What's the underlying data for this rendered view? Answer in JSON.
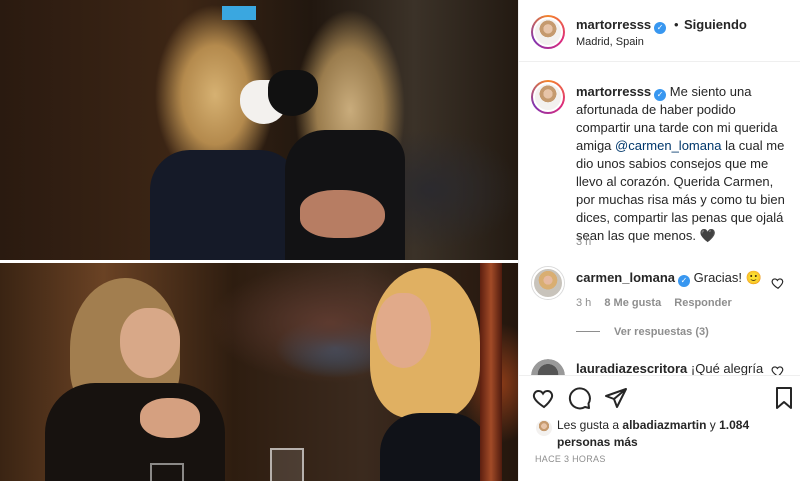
{
  "post": {
    "author": {
      "username": "martorresss",
      "verified_mark": "✓",
      "location": "Madrid, Spain"
    },
    "follow_separator": "•",
    "follow_status": "Siguiendo",
    "caption": {
      "text_before_mention": "Me siento una afortunada de haber podido compartir una tarde con mi querida amiga ",
      "mention": "@carmen_lomana",
      "text_after_mention": " la cual me dio unos sabios consejos que me llevo al corazón. Querida Carmen, por muchas risa más y como tu bien dices, compartir las penas que ojalá sean las que menos. 🖤",
      "time": "3 h"
    },
    "comments": [
      {
        "username": "carmen_lomana",
        "verified_mark": "✓",
        "text": "Gracias! 🙂",
        "time": "3 h",
        "likes": "8 Me gusta",
        "reply_label": "Responder",
        "view_replies": "Ver respuestas (3)"
      },
      {
        "username": "lauradiazescritora",
        "text": "¡Qué alegría"
      }
    ],
    "likes": {
      "prefix": "Les gusta a ",
      "first_user": "albadiazmartin",
      "middle": " y ",
      "others": "1.084 personas más"
    },
    "timestamp": "HACE 3 HORAS"
  },
  "icons": {
    "like": "heart-icon",
    "comment": "comment-icon",
    "share": "paper-plane-icon",
    "save": "bookmark-icon"
  },
  "colors": {
    "verified": "#3897f0",
    "mention": "#00376b",
    "muted": "#8e8e8e",
    "text": "#262626"
  }
}
